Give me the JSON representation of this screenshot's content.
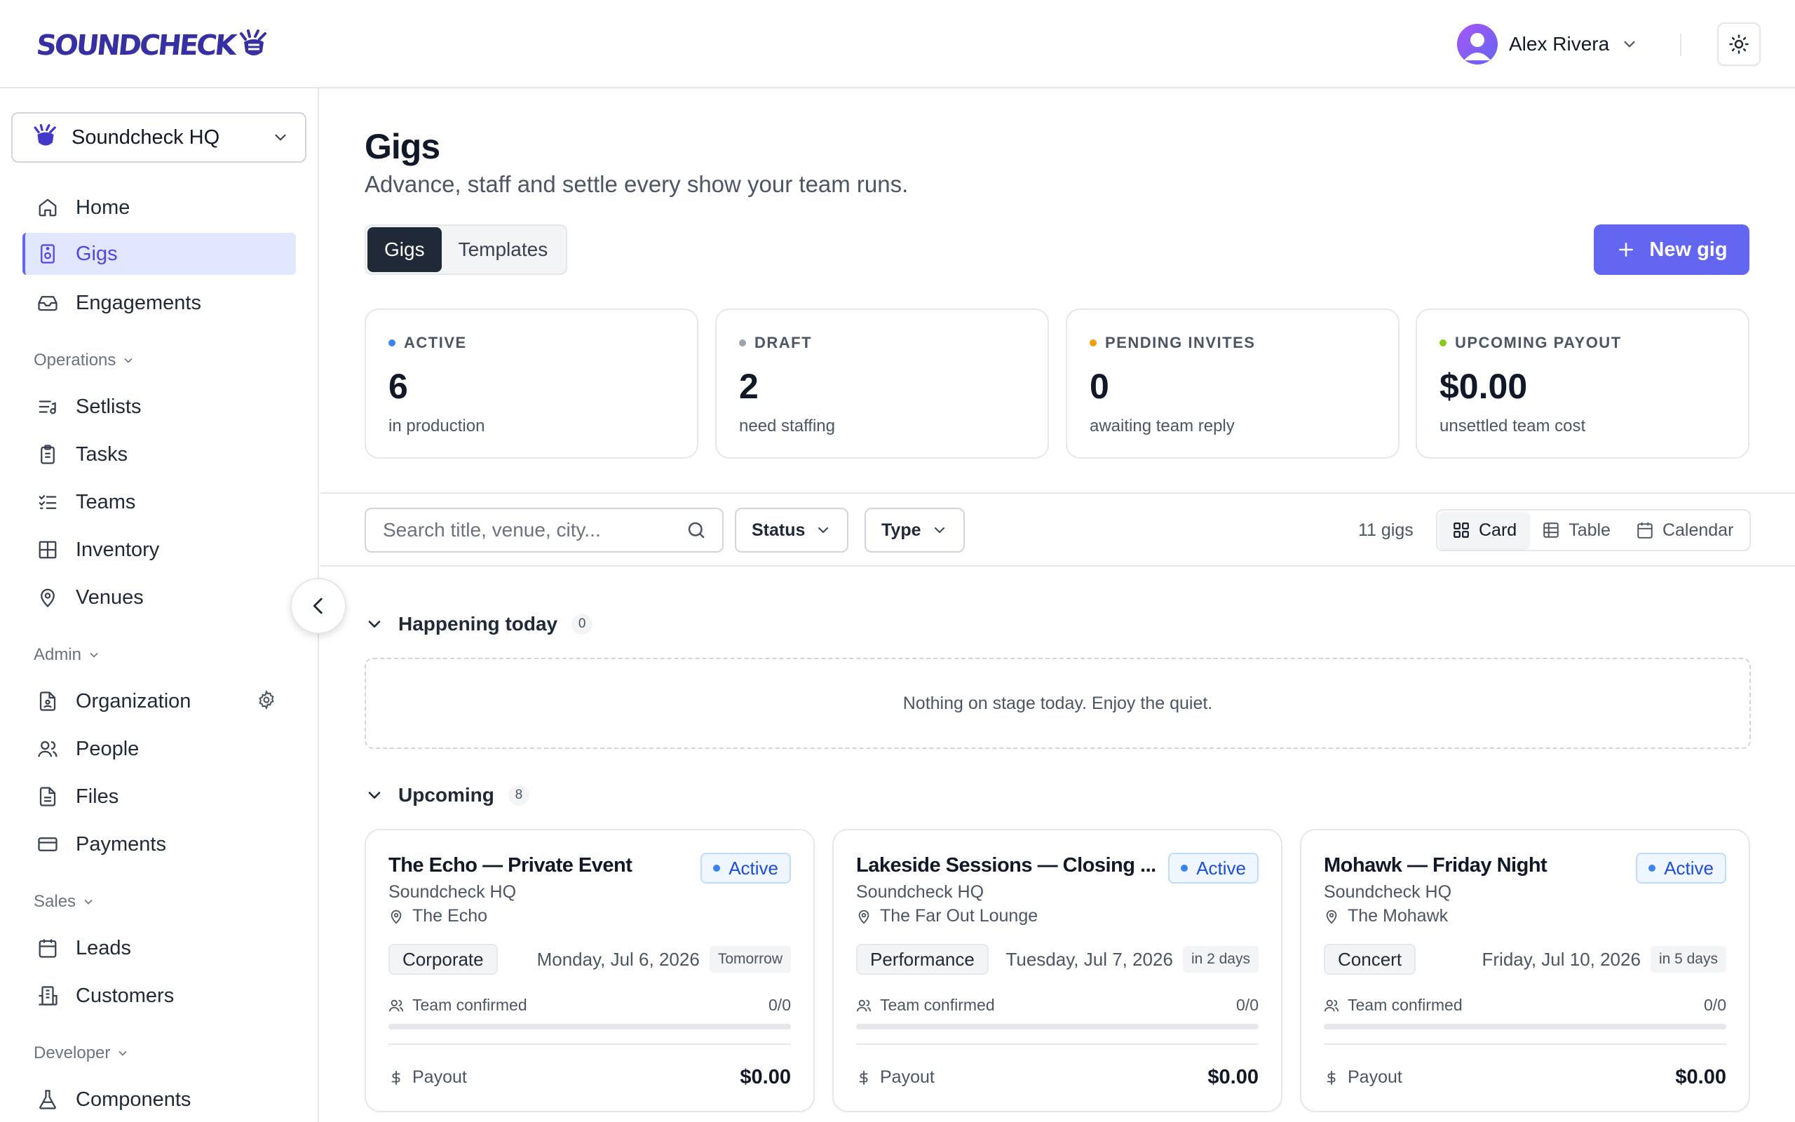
{
  "brand": {
    "logo_text": "SOUNDCHECK"
  },
  "header": {
    "user_name": "Alex Rivera"
  },
  "sidebar": {
    "org_name": "Soundcheck HQ",
    "main_items": [
      {
        "label": "Home",
        "icon": "home-icon"
      },
      {
        "label": "Gigs",
        "icon": "gig-icon",
        "active": true
      },
      {
        "label": "Engagements",
        "icon": "inbox-icon"
      }
    ],
    "sections": [
      {
        "title": "Operations",
        "items": [
          {
            "label": "Setlists",
            "icon": "list-music-icon"
          },
          {
            "label": "Tasks",
            "icon": "clipboard-icon"
          },
          {
            "label": "Teams",
            "icon": "list-checks-icon"
          },
          {
            "label": "Inventory",
            "icon": "boxes-icon"
          },
          {
            "label": "Venues",
            "icon": "map-pin-icon"
          }
        ]
      },
      {
        "title": "Admin",
        "items": [
          {
            "label": "Organization",
            "icon": "file-user-icon"
          },
          {
            "label": "People",
            "icon": "users-icon"
          },
          {
            "label": "Files",
            "icon": "file-icon"
          },
          {
            "label": "Payments",
            "icon": "credit-card-icon"
          }
        ]
      },
      {
        "title": "Sales",
        "items": [
          {
            "label": "Leads",
            "icon": "calendar-icon"
          },
          {
            "label": "Customers",
            "icon": "building-icon"
          }
        ]
      },
      {
        "title": "Developer",
        "items": [
          {
            "label": "Components",
            "icon": "flask-icon"
          }
        ]
      }
    ]
  },
  "page": {
    "title": "Gigs",
    "subtitle": "Advance, staff and settle every show your team runs.",
    "tabs": [
      "Gigs",
      "Templates"
    ],
    "new_button": "New gig"
  },
  "stats": [
    {
      "label": "ACTIVE",
      "value": "6",
      "note": "in production",
      "color": "#3b82f6"
    },
    {
      "label": "DRAFT",
      "value": "2",
      "note": "need staffing",
      "color": "#9ca3af"
    },
    {
      "label": "PENDING INVITES",
      "value": "0",
      "note": "awaiting team reply",
      "color": "#f59e0b"
    },
    {
      "label": "UPCOMING PAYOUT",
      "value": "$0.00",
      "note": "unsettled team cost",
      "color": "#84cc16"
    }
  ],
  "filters": {
    "search_placeholder": "Search title, venue, city...",
    "status_label": "Status",
    "type_label": "Type",
    "count": "11 gigs",
    "views": [
      "Card",
      "Table",
      "Calendar"
    ]
  },
  "sections": {
    "today": {
      "title": "Happening today",
      "count": "0",
      "empty": "Nothing on stage today. Enjoy the quiet."
    },
    "upcoming": {
      "title": "Upcoming",
      "count": "8"
    }
  },
  "gigs": [
    {
      "title": "The Echo — Private Event",
      "org": "Soundcheck HQ",
      "venue": "The Echo",
      "status": "Active",
      "type": "Corporate",
      "date": "Monday, Jul 6, 2026",
      "relative": "Tomorrow",
      "team_label": "Team confirmed",
      "team": "0/0",
      "team_progress": 0,
      "payout_label": "Payout",
      "payout": "$0.00"
    },
    {
      "title": "Lakeside Sessions — Closing ...",
      "org": "Soundcheck HQ",
      "venue": "The Far Out Lounge",
      "status": "Active",
      "type": "Performance",
      "date": "Tuesday, Jul 7, 2026",
      "relative": "in 2 days",
      "team_label": "Team confirmed",
      "team": "0/0",
      "team_progress": 0,
      "payout_label": "Payout",
      "payout": "$0.00"
    },
    {
      "title": "Mohawk — Friday Night",
      "org": "Soundcheck HQ",
      "venue": "The Mohawk",
      "status": "Active",
      "type": "Concert",
      "date": "Friday, Jul 10, 2026",
      "relative": "in 5 days",
      "team_label": "Team confirmed",
      "team": "0/0",
      "team_progress": 0,
      "payout_label": "Payout",
      "payout": "$0.00"
    }
  ],
  "colors": {
    "accent": "#6366f1",
    "active_nav_bg": "#e0e7ff",
    "status_blue": "#1d4ed8"
  }
}
